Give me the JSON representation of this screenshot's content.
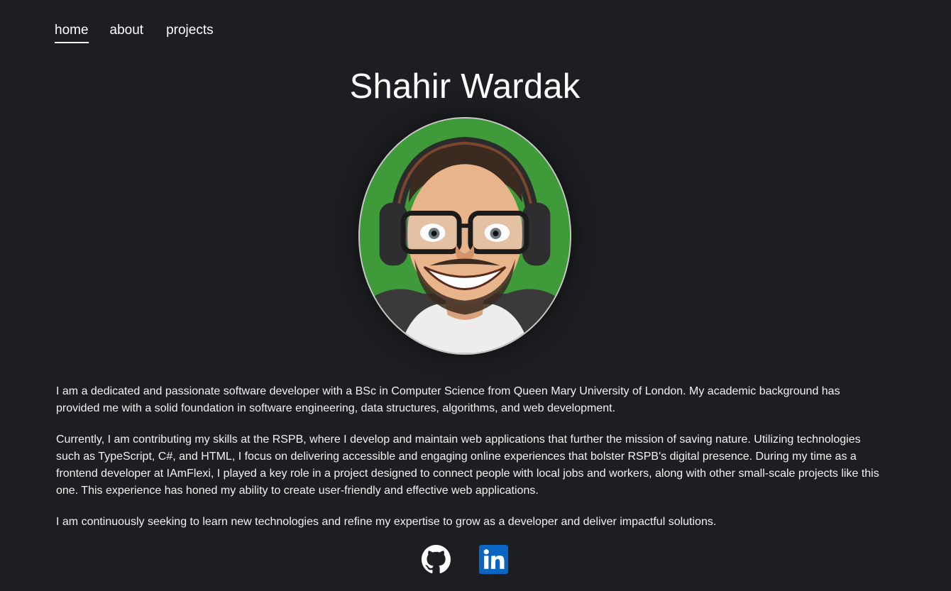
{
  "nav": {
    "items": [
      {
        "label": "home"
      },
      {
        "label": "about"
      },
      {
        "label": "projects"
      }
    ]
  },
  "hero": {
    "name": "Shahir Wardak"
  },
  "bio": {
    "paragraphs": [
      "I am a dedicated and passionate software developer with a BSc in Computer Science from Queen Mary University of London. My academic background has provided me with a solid foundation in software engineering, data structures, algorithms, and web development.",
      "Currently, I am contributing my skills at the RSPB, where I develop and maintain web applications that further the mission of saving nature. Utilizing technologies such as TypeScript, C#, and HTML, I focus on delivering accessible and engaging online experiences that bolster RSPB's digital presence. During my time as a frontend developer at IAmFlexi, I played a key role in a project designed to connect people with local jobs and workers, along with other small-scale projects like this one. This experience has honed my ability to create user-friendly and effective web applications.",
      "I am continuously seeking to learn new technologies and refine my expertise to grow as a developer and deliver impactful solutions."
    ]
  },
  "socials": [
    {
      "icon": "github-icon"
    },
    {
      "icon": "linkedin-icon"
    }
  ],
  "colors": {
    "background": "#1d1e21",
    "text": "#ffffff",
    "avatar_bg": "#3f9b3a",
    "linkedin": "#0a66c2"
  }
}
